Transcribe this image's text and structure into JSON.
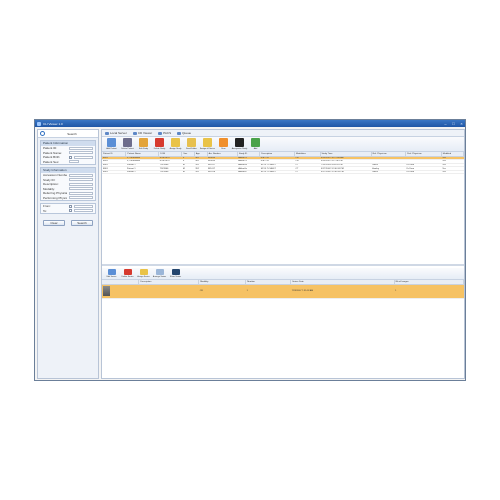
{
  "window": {
    "title": "CLI Viewer 1.0"
  },
  "left_panel": {
    "search_label": "Search",
    "patient_group": {
      "title": "Patient Information",
      "fields": [
        "Patient ID:",
        "Patient Name:",
        "Patient Birth:",
        "Patient Sex:"
      ]
    },
    "study_group": {
      "title": "Study Information",
      "fields": [
        "Accession Number:",
        "Study ID:",
        "Description:",
        "Modality:",
        "Referring Physician:",
        "Performing Physician:"
      ]
    },
    "date_fields": [
      "From:",
      "To:"
    ],
    "clear_label": "Clear",
    "search_button": "Search"
  },
  "tabs": [
    {
      "label": "Local Server"
    },
    {
      "label": "CD Viewer"
    },
    {
      "label": "PACS"
    },
    {
      "label": "Queue"
    }
  ],
  "top_toolbar": [
    {
      "label": "Add Patient",
      "icon": "add-patient-icon",
      "color": "#5b8fd6"
    },
    {
      "label": "Delete Patient",
      "icon": "delete-patient-icon",
      "color": "#6d6d8c"
    },
    {
      "label": "Edit Study",
      "icon": "edit-study-icon",
      "color": "#e3a43a"
    },
    {
      "label": "Delete Study",
      "icon": "delete-study-icon",
      "color": "#d63a2f"
    },
    {
      "label": "Assign Study",
      "icon": "assign-study-icon",
      "color": "#e9c348"
    },
    {
      "label": "Send Folder",
      "icon": "send-folder-icon",
      "color": "#e7c04f"
    },
    {
      "label": "Assign all Series",
      "icon": "assign-series-icon",
      "color": "#e9c348"
    },
    {
      "label": "Burn",
      "icon": "burn-icon",
      "color": "#f08f2c"
    },
    {
      "label": "Anonymize Study",
      "icon": "anonymize-icon",
      "color": "#222222"
    },
    {
      "label": "Add",
      "icon": "add-icon",
      "color": "#4aa24a"
    }
  ],
  "study_table": {
    "columns": [
      "Patient ID",
      "Patient Name",
      "DOB",
      "Sex",
      "Age",
      "Acc Number",
      "Study ID",
      "Description",
      "Modalities",
      "Study Time",
      "Ref. Physician",
      "Perf. Physician",
      "Modified"
    ],
    "rows": [
      [
        "8851",
        "X, Fernandez",
        "8/16/1970",
        "F",
        "58Y",
        "IN0035",
        "Adhoc21",
        "H.B. CR",
        "CR",
        "6/20/2007 10:17:06 AM",
        "",
        "",
        "Yes"
      ],
      [
        "8851",
        "X, Fernandez",
        "8/16/1970",
        "F",
        "58Y",
        "IN0035",
        "Adhoc21",
        "H.B. CR",
        "CR",
        "6/20/2007 5:17:06 PM",
        "",
        "",
        "Yes"
      ],
      [
        "8801",
        "Patient 1",
        "7/9/1966",
        "M",
        "35Y",
        "IN1017",
        "Adhoc6e",
        "SP. R.T.CHEST",
        "CT",
        "7/25/2003 9:54:53 PM",
        "Goshi",
        "Dr Dom",
        "Yes"
      ],
      [
        "8801",
        "Patient 1",
        "7/9/1966",
        "M",
        "35Y",
        "IN1017",
        "Adhoc6e",
        "SP. R.T.CHEST",
        "CT",
        "6/17/2002 12:30:18 PM",
        "Hanley",
        "Dr Dom",
        "Yes"
      ],
      [
        "8801",
        "Patient 1",
        "7/9/1966",
        "M",
        "35Y",
        "IN1018",
        "Adhoc6f",
        "SP. R.T.CHEST",
        "CT",
        "6/17/2002 12:30:18 PM",
        "Goshi",
        "Dr Dom",
        "Yes"
      ]
    ],
    "selected_index": 0
  },
  "bottom_toolbar": [
    {
      "label": "Edit Series",
      "icon": "edit-series-icon",
      "color": "#5b8fd6"
    },
    {
      "label": "Delete Series",
      "icon": "delete-series-icon",
      "color": "#d63a2f"
    },
    {
      "label": "Assign Series",
      "icon": "assign-series-icon",
      "color": "#e9c348"
    },
    {
      "label": "Arrange Series",
      "icon": "arrange-series-icon",
      "color": "#9bb6d8"
    },
    {
      "label": "Show Series",
      "icon": "show-series-icon",
      "color": "#24466e"
    }
  ],
  "series_table": {
    "columns": [
      "",
      "Description",
      "Modality",
      "Number",
      "Series Date",
      "Nb of Images"
    ],
    "rows": [
      [
        "",
        "",
        "CR",
        "1",
        "7/28/2007 7:35:18 AM",
        "1"
      ]
    ]
  }
}
